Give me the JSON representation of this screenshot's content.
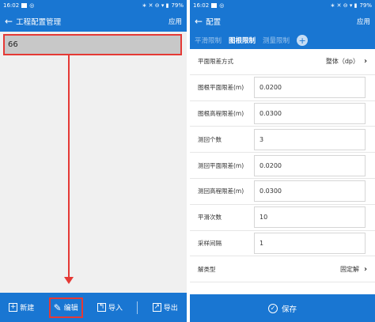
{
  "left": {
    "status": {
      "time": "16:02",
      "icons": "∗ ✕ ⊖ ▾ ▮",
      "battery": "79%"
    },
    "title": "工程配置管理",
    "action": "应用",
    "project_item": "66",
    "bottom": {
      "new": "新建",
      "edit": "编辑",
      "import": "导入",
      "export": "导出"
    }
  },
  "right": {
    "status": {
      "time": "16:02",
      "icons": "∗ ✕ ⊖ ▾ ▮",
      "battery": "79%"
    },
    "title": "配置",
    "action": "应用",
    "tabs": [
      "平滑限制",
      "图根限制",
      "测量限制"
    ],
    "active_tab": 1,
    "rows": [
      {
        "label": "平面限差方式",
        "value": "整体（dp）",
        "type": "select"
      },
      {
        "label": "图根平面限差(m)",
        "value": "0.0200",
        "type": "input"
      },
      {
        "label": "图根高程限差(m)",
        "value": "0.0300",
        "type": "input"
      },
      {
        "label": "测回个数",
        "value": "3",
        "type": "input"
      },
      {
        "label": "测回平面限差(m)",
        "value": "0.0200",
        "type": "input"
      },
      {
        "label": "测回高程限差(m)",
        "value": "0.0300",
        "type": "input"
      },
      {
        "label": "平滑次数",
        "value": "10",
        "type": "input"
      },
      {
        "label": "采样间隔",
        "value": "1",
        "type": "input"
      },
      {
        "label": "解类型",
        "value": "固定解",
        "type": "select"
      }
    ],
    "save": "保存"
  },
  "colors": {
    "primary": "#1976d2",
    "highlight": "#e53935",
    "item_bg": "#c8c8c8"
  }
}
